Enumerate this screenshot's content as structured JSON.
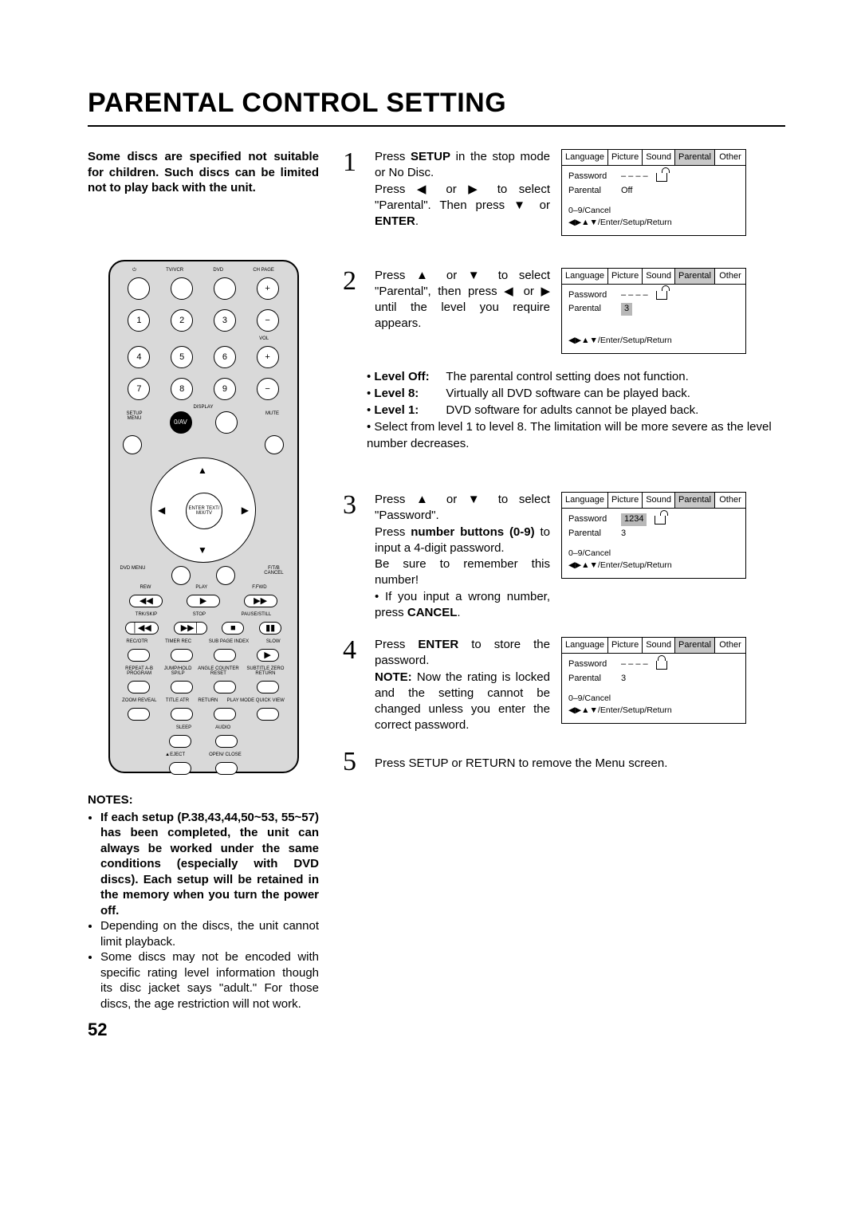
{
  "title": "PARENTAL CONTROL SETTING",
  "intro": "Some discs are specified not suitable for children. Such discs can be limited not to play back with the unit.",
  "page_number": "52",
  "remote": {
    "top_labels": [
      "",
      "TV/VCR",
      "DVD",
      "CH PAGE"
    ],
    "nums": [
      "1",
      "2",
      "3",
      "4",
      "5",
      "6",
      "7",
      "8",
      "9"
    ],
    "vol": "VOL",
    "display": "DISPLAY",
    "zero_av": "0/AV",
    "setup_menu": "SETUP MENU",
    "mute": "MUTE",
    "dvd_menu": "DVD MENU",
    "ftb_cancel": "F/T/B CANCEL",
    "enter": "ENTER TEXT/ MIX/TV",
    "row_play": [
      "REW",
      "PLAY",
      "F.FWD"
    ],
    "row_trk": [
      "TRK/SKIP",
      "STOP",
      "PAUSE/STILL"
    ],
    "row_rec": [
      "REC/OTR",
      "TIMER REC",
      "SUB PAGE INDEX",
      "SLOW"
    ],
    "row_repeat": [
      "REPEAT A-B PROGRAM",
      "JUMP/HOLD SP/LP",
      "ANGLE COUNTER RESET",
      "SUBTITLE ZERO RETURN"
    ],
    "row_zoom": [
      "ZOOM REVEAL",
      "TITLE ATR",
      "RETURN",
      "PLAY MODE QUICK VIEW"
    ],
    "row_sleep": [
      "SLEEP",
      "AUDIO"
    ],
    "row_eject": [
      "▲EJECT",
      "OPEN/ CLOSE"
    ]
  },
  "notes_head": "NOTES:",
  "notes": {
    "n1": "If each setup (P.38,43,44,50~53, 55~57) has been  completed, the unit can always be worked under the same conditions (especially with DVD discs). Each setup will be retained in the memory when you turn the power off.",
    "n2": "Depending on the discs, the unit cannot limit playback.",
    "n3": "Some discs may not be encoded with specific rating level information though its disc jacket says \"adult.\" For those discs, the age restriction will not work."
  },
  "steps": {
    "s1": {
      "text_parts": [
        "Press ",
        "SETUP",
        " in the stop mode or No Disc.",
        "Press ◀ or ▶ to select \"Parental\". Then press ▼ or ",
        "ENTER",
        "."
      ]
    },
    "s2": {
      "text": "Press ▲ or ▼ to select \"Parental\", then press ◀ or ▶ until the level you require appears."
    },
    "s3": {
      "line1": "Press ▲ or ▼ to select \"Password\".",
      "line2_a": "Press ",
      "line2_b": "number buttons (0-9)",
      "line2_c": " to input a 4-digit  password.",
      "line3": "Be sure to remember this number!",
      "bullet": "If you input a wrong number, press ",
      "bullet_b": "CANCEL",
      "bullet_c": "."
    },
    "s4": {
      "line1_a": "Press ",
      "line1_b": "ENTER",
      "line1_c": " to store the password.",
      "line2_a": "NOTE:",
      "line2_b": " Now the rating is locked and the setting cannot be changed unless you enter the correct password."
    },
    "s5_a": "Press ",
    "s5_b": "SETUP",
    "s5_c": " or ",
    "s5_d": "RETURN",
    "s5_e": " to remove the Menu screen."
  },
  "levels": {
    "off_label": "Level Off:",
    "off_text": "The parental control setting does not function.",
    "l8_label": "Level 8:",
    "l8_text": "Virtually all DVD software can be played back.",
    "l1_label": "Level 1:",
    "l1_text": "DVD software for adults cannot be played back.",
    "select_text": "Select from level 1 to level 8. The limitation will be more severe as the level number decreases."
  },
  "menu": {
    "tabs": [
      "Language",
      "Picture",
      "Sound",
      "Parental",
      "Other"
    ],
    "password_label": "Password",
    "parental_label": "Parental",
    "hint_cancel": "0–9/Cancel",
    "hint_nav": "◀▶▲▼/Enter/Setup/Return",
    "box1": {
      "password": "– – – –",
      "parental": "Off"
    },
    "box2": {
      "password": "– – – –",
      "parental": "3"
    },
    "box3": {
      "password": "1234",
      "parental": "3"
    },
    "box4": {
      "password": "– – – –",
      "parental": "3"
    }
  }
}
